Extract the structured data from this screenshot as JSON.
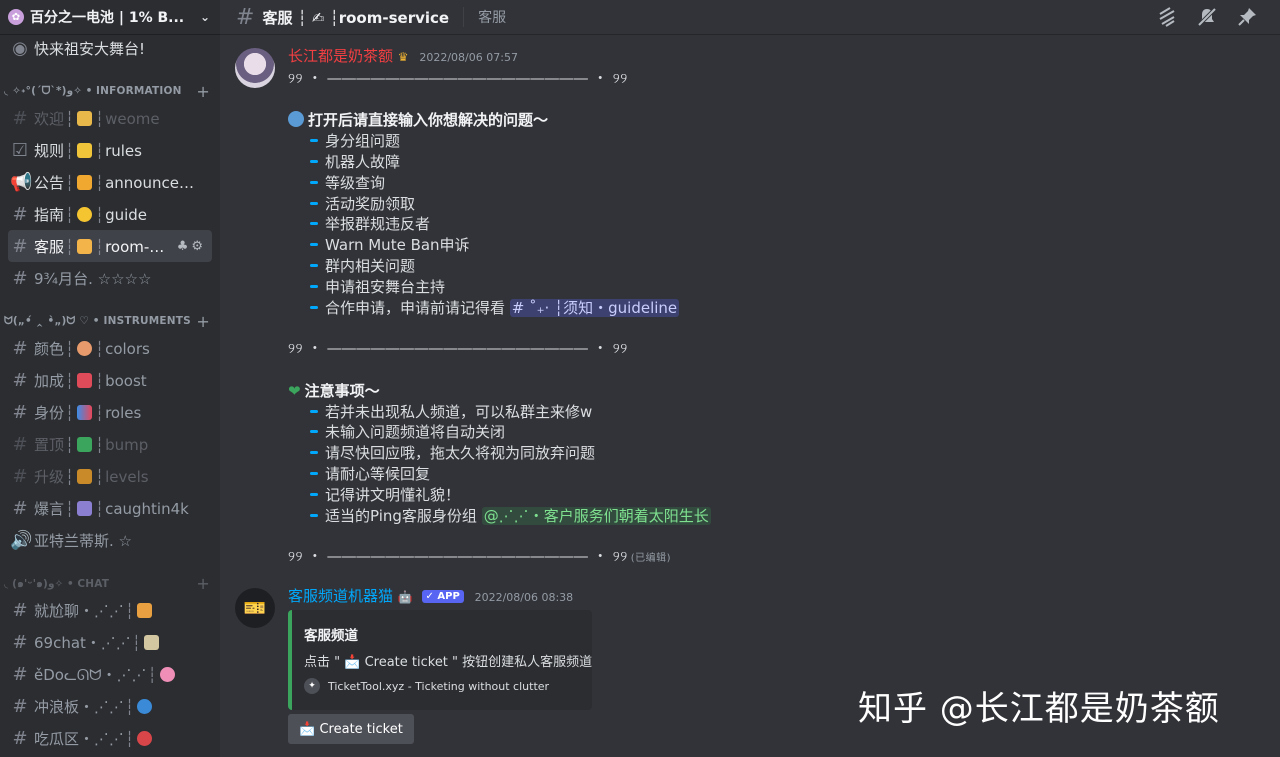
{
  "server": {
    "name": "百分之一电池 | 1% B...",
    "icon": "flower-icon"
  },
  "sidebar": {
    "stage": "快来祖安大舞台!",
    "categories": [
      {
        "name": "◟ ✧˖°(ˊᗜˋ*)ﻭ✧ • INFORMATION"
      },
      {
        "name": "ᗢ(„•́ ‸ •̀„)ᗢ ♡ • INSTRUMENTS"
      },
      {
        "name": "◟ (๑'ᵕ'๑)ﻭ✧ • CHAT"
      }
    ],
    "channels": [
      {
        "zh": "欢迎",
        "en": "weome",
        "icon": "wave-emoji"
      },
      {
        "zh": "规则",
        "en": "rules",
        "icon": "notebook-emoji"
      },
      {
        "zh": "公告",
        "en": "announceme...",
        "icon": "bell-emoji"
      },
      {
        "zh": "指南",
        "en": "guide",
        "icon": "sun-emoji"
      },
      {
        "zh": "客服",
        "en": "room-s...",
        "icon": "writing-hand-emoji"
      },
      {
        "full": "9¾月台. ☆☆☆☆"
      },
      {
        "zh": "颜色",
        "en": "colors",
        "icon": "palette-emoji"
      },
      {
        "zh": "加成",
        "en": "boost",
        "icon": "heart-emoji"
      },
      {
        "zh": "身份",
        "en": "roles",
        "icon": "bookmark-emoji"
      },
      {
        "zh": "置顶",
        "en": "bump",
        "icon": "check-emoji"
      },
      {
        "zh": "升级",
        "en": "levels",
        "icon": "trophy-emoji"
      },
      {
        "zh": "爆言",
        "en": "caughtin4k",
        "icon": "camera-emoji"
      },
      {
        "full": "亚特兰蒂斯. ☆"
      },
      {
        "full": "就尬聊・⋰⋰"
      },
      {
        "full": "69chat・⋰⋰"
      },
      {
        "full": "ěDoᓚᘏᗢ・⋰⋰"
      },
      {
        "full": "冲浪板・⋰⋰"
      },
      {
        "full": "吃瓜区・⋰⋰"
      }
    ]
  },
  "topbar": {
    "title": "客服 ┆ ✍ ┆room-service",
    "topic": "客服"
  },
  "msg1": {
    "author": "长江都是奶茶额",
    "timestamp": "2022/08/06 07:57",
    "divider": "୨୨ ・ ―――――――――――――――――― ・ ୨୨",
    "divider2": "୨୨ ・ ―――――――――――――――――― ・ ୨୨",
    "divider3": "୨୨ ・ ―――――――――――――――――― ・ ୨୨",
    "edited": "(已编辑)",
    "heading1": "打开后请直接输入你想解决的问题～",
    "items1": [
      "身分组问题",
      "机器人故障",
      "等级查询",
      "活动奖励领取",
      "举报群规违反者",
      "Warn Mute Ban申诉",
      "群内相关问题",
      "申请祖安舞台主持"
    ],
    "item_last_text": "合作申请，申请前请记得看",
    "item_last_mention": "# ˚₊‧ ┆须知・guideline",
    "heading2": "注意事项～",
    "items2": [
      "若并未出现私人频道，可以私群主来修w",
      "未输入问题频道将自动关闭",
      "请尽快回应哦，拖太久将视为同放弃问题",
      "请耐心等候回复",
      "记得讲文明懂礼貌！"
    ],
    "item2_last_text": "适当的Ping客服身份组",
    "item2_last_mention": "@⋰⋰・客户服务们朝着太阳生长"
  },
  "msg2": {
    "author": "客服频道机器猫",
    "badge": "✓ APP",
    "timestamp": "2022/08/06 08:38",
    "embed_title": "客服频道",
    "embed_desc": "点击 \" 📩 Create ticket \" 按钮创建私人客服频道",
    "embed_footer": "TicketTool.xyz - Ticketing without clutter",
    "button": "📩 Create ticket"
  },
  "watermark": "知乎 @长江都是奶茶额",
  "colors": {
    "author1": "#f23f42",
    "author2": "#00a8fc",
    "accent": "#5865f2",
    "embed_border": "#3ba55d"
  }
}
